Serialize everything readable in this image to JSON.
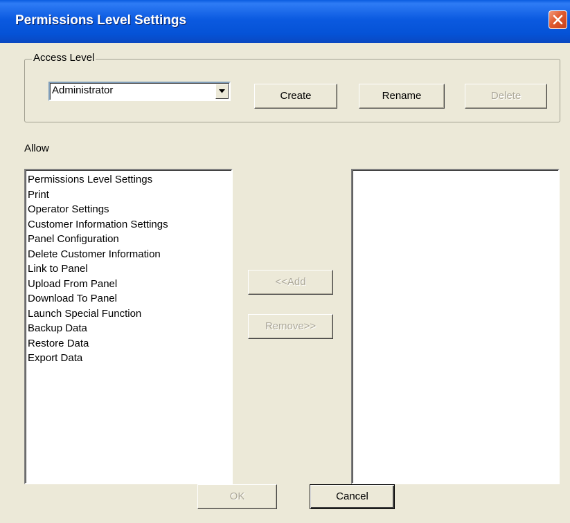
{
  "window": {
    "title": "Permissions Level Settings",
    "close_icon": "close-icon"
  },
  "access_level": {
    "legend": "Access Level",
    "selected": "Administrator",
    "create_label": "Create",
    "rename_label": "Rename",
    "delete_label": "Delete"
  },
  "allow": {
    "label": "Allow",
    "available_items": [
      "Permissions Level Settings",
      "Print",
      "Operator Settings",
      "Customer Information Settings",
      "Panel Configuration",
      "Delete Customer Information",
      "Link to Panel",
      "Upload From Panel",
      "Download To Panel",
      "Launch Special Function",
      "Backup Data",
      "Restore Data",
      "Export Data"
    ],
    "selected_items": [],
    "add_label": "<<Add",
    "remove_label": "Remove>>"
  },
  "footer": {
    "ok_label": "OK",
    "cancel_label": "Cancel"
  }
}
